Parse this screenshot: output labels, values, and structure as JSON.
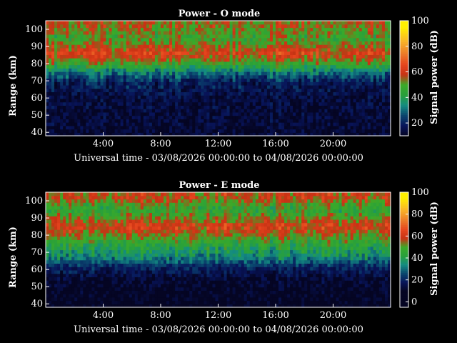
{
  "chart_data": [
    {
      "type": "heatmap",
      "title": "Power - O mode",
      "xlabel": "Universal time - 03/08/2026 00:00:00 to 04/08/2026 00:00:00",
      "ylabel": "Range (km)",
      "x_ticks": [
        "4:00",
        "8:00",
        "12:00",
        "16:00",
        "20:00"
      ],
      "x_tick_hours": [
        4,
        8,
        12,
        16,
        20
      ],
      "xlim_hours": [
        0,
        24
      ],
      "y_ticks": [
        40,
        50,
        60,
        70,
        80,
        90,
        100
      ],
      "ylim_km": [
        38,
        105
      ],
      "colorbar": {
        "label": "Signal power (dB)",
        "ticks": [
          20,
          40,
          60,
          80,
          100
        ],
        "range": [
          10,
          100
        ]
      },
      "summary_by_range_km": [
        {
          "range_km": 40,
          "power_db": 12
        },
        {
          "range_km": 60,
          "power_db": 14
        },
        {
          "range_km": 70,
          "power_db": 20
        },
        {
          "range_km": 75,
          "power_db": 32
        },
        {
          "range_km": 80,
          "power_db": 48
        },
        {
          "range_km": 86,
          "power_db": 62
        },
        {
          "range_km": 95,
          "power_db": 48
        },
        {
          "range_km": 102,
          "power_db": 55
        }
      ]
    },
    {
      "type": "heatmap",
      "title": "Power - E mode",
      "xlabel": "Universal time - 03/08/2026 00:00:00 to 04/08/2026 00:00:00",
      "ylabel": "Range (km)",
      "x_ticks": [
        "4:00",
        "8:00",
        "12:00",
        "16:00",
        "20:00"
      ],
      "x_tick_hours": [
        4,
        8,
        12,
        16,
        20
      ],
      "xlim_hours": [
        0,
        24
      ],
      "y_ticks": [
        40,
        50,
        60,
        70,
        80,
        90,
        100
      ],
      "ylim_km": [
        38,
        105
      ],
      "colorbar": {
        "label": "Signal power (dB)",
        "ticks": [
          0,
          20,
          40,
          60,
          80,
          100
        ],
        "range": [
          -5,
          100
        ]
      },
      "summary_by_range_km": [
        {
          "range_km": 40,
          "power_db": 8
        },
        {
          "range_km": 55,
          "power_db": 12
        },
        {
          "range_km": 62,
          "power_db": 22
        },
        {
          "range_km": 68,
          "power_db": 35
        },
        {
          "range_km": 75,
          "power_db": 45
        },
        {
          "range_km": 85,
          "power_db": 62
        },
        {
          "range_km": 95,
          "power_db": 45
        },
        {
          "range_km": 102,
          "power_db": 58
        }
      ]
    }
  ]
}
